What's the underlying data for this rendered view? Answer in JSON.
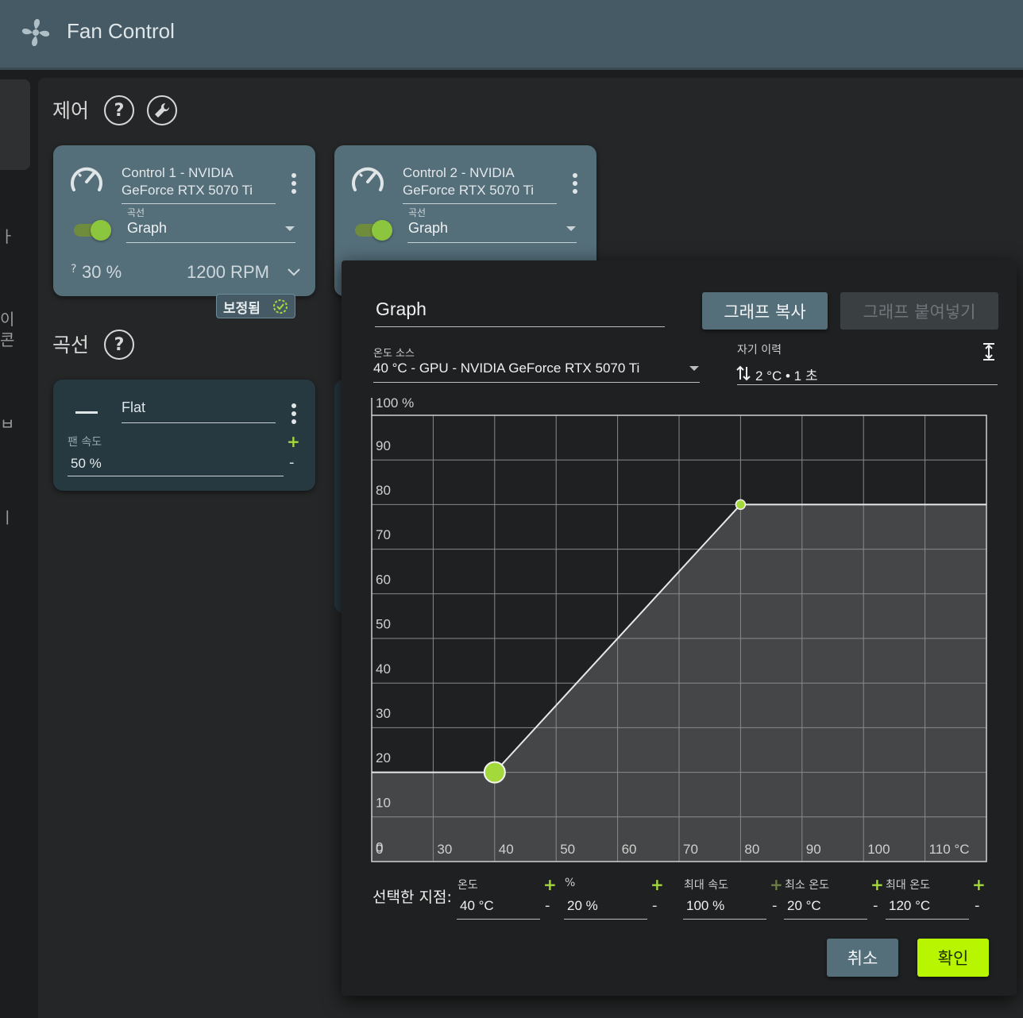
{
  "app": {
    "title": "Fan Control"
  },
  "rail": {
    "chars": [
      "ㅏ",
      "이",
      "콘",
      "ㅂ",
      "ㅣ"
    ]
  },
  "controls_section": {
    "title": "제어"
  },
  "controls": [
    {
      "name_line1": "Control 1 - NVIDIA",
      "name_line2": "GeForce RTX 5070 Ti",
      "curve_label": "곡선",
      "curve_value": "Graph",
      "enabled": true,
      "percent": "30 %",
      "percent_prefix": "?",
      "rpm": "1200 RPM"
    },
    {
      "name_line1": "Control 2 - NVIDIA",
      "name_line2": "GeForce RTX 5070 Ti",
      "curve_label": "곡선",
      "curve_value": "Graph",
      "enabled": true
    }
  ],
  "calibrated_badge": {
    "label": "보정됨"
  },
  "curves_section": {
    "title": "곡선"
  },
  "flat_curve": {
    "name": "Flat",
    "speed_label": "팬 속도",
    "speed_value": "50 %",
    "plus": "+",
    "minus": "-"
  },
  "dialog": {
    "name_value": "Graph",
    "copy_button": "그래프 복사",
    "paste_button": "그래프 붙여넣기",
    "temp_source_label": "온도 소스",
    "temp_source_value": "40 °C - GPU - NVIDIA GeForce RTX 5070 Ti",
    "hysteresis_label": "자기 이력",
    "hysteresis_value": "2 °C • 1 초",
    "selected_point_label": "선택한 지점:",
    "fields": [
      {
        "label": "온도",
        "value": "40 °C"
      },
      {
        "label": "%",
        "value": "20 %"
      },
      {
        "label": "최대 속도",
        "value": "100 %"
      },
      {
        "label": "최소 온도",
        "value": "20 °C"
      },
      {
        "label": "최대 온도",
        "value": "120 °C"
      }
    ],
    "plus": "+",
    "minus": "-",
    "cancel_button": "취소",
    "ok_button": "확인"
  },
  "chart_data": {
    "type": "line",
    "x_ticks": [
      "0",
      "30",
      "40",
      "50",
      "60",
      "70",
      "80",
      "90",
      "100",
      "110 °C"
    ],
    "y_ticks": [
      "100 %",
      "90",
      "80",
      "70",
      "60",
      "50",
      "40",
      "30",
      "20",
      "10",
      "0"
    ],
    "points": [
      {
        "x": 40,
        "y": 20,
        "selected": true
      },
      {
        "x": 80,
        "y": 80,
        "selected": false
      }
    ],
    "line_color": "#e8e8e8",
    "point_color": "#a4d93c",
    "fill_color": "#454647"
  },
  "colors": {
    "accent": "#a4d93c",
    "header": "#455a64",
    "card": "#546e7a"
  }
}
